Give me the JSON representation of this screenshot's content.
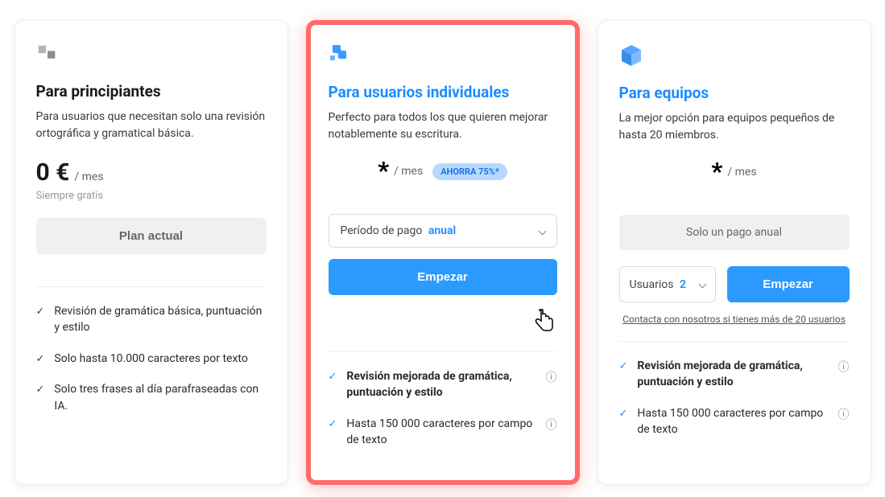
{
  "plans": {
    "beginner": {
      "title": "Para principiantes",
      "desc": "Para usuarios que necesitan solo una revisión ortográfica y gramatical básica.",
      "price": "0 €",
      "period": "/ mes",
      "note": "Siempre gratis",
      "cta": "Plan actual",
      "features": [
        "Revisión de gramática básica, puntuación y estilo",
        "Solo hasta 10.000 caracteres por texto",
        "Solo tres frases al día parafraseadas con IA."
      ]
    },
    "individual": {
      "title": "Para usuarios individuales",
      "desc": "Perfecto para todos los que quieren mejorar notablemente su escritura.",
      "price_symbol": "*",
      "period": "/ mes",
      "save_badge": "AHORRA 75%*",
      "period_label": "Período de pago",
      "period_value": "anual",
      "cta": "Empezar",
      "features": [
        {
          "text": "Revisión mejorada de gramática, puntuación y estilo",
          "bold": true,
          "info": true
        },
        {
          "text": "Hasta 150 000 caracteres por campo de texto",
          "bold": false,
          "info": true
        }
      ]
    },
    "team": {
      "title": "Para equipos",
      "desc": "La mejor opción para equipos pequeños de hasta 20 miembros.",
      "price_symbol": "*",
      "period": "/ mes",
      "annual_note": "Solo un pago anual",
      "users_label": "Usuarios",
      "users_value": "2",
      "cta": "Empezar",
      "contact_link": "Contacta con nosotros si tienes más de 20 usuarios",
      "features": [
        {
          "text": "Revisión mejorada de gramática, puntuación y estilo",
          "bold": true,
          "info": true
        },
        {
          "text": "Hasta 150 000 caracteres por campo de texto",
          "bold": false,
          "info": true
        }
      ]
    }
  }
}
